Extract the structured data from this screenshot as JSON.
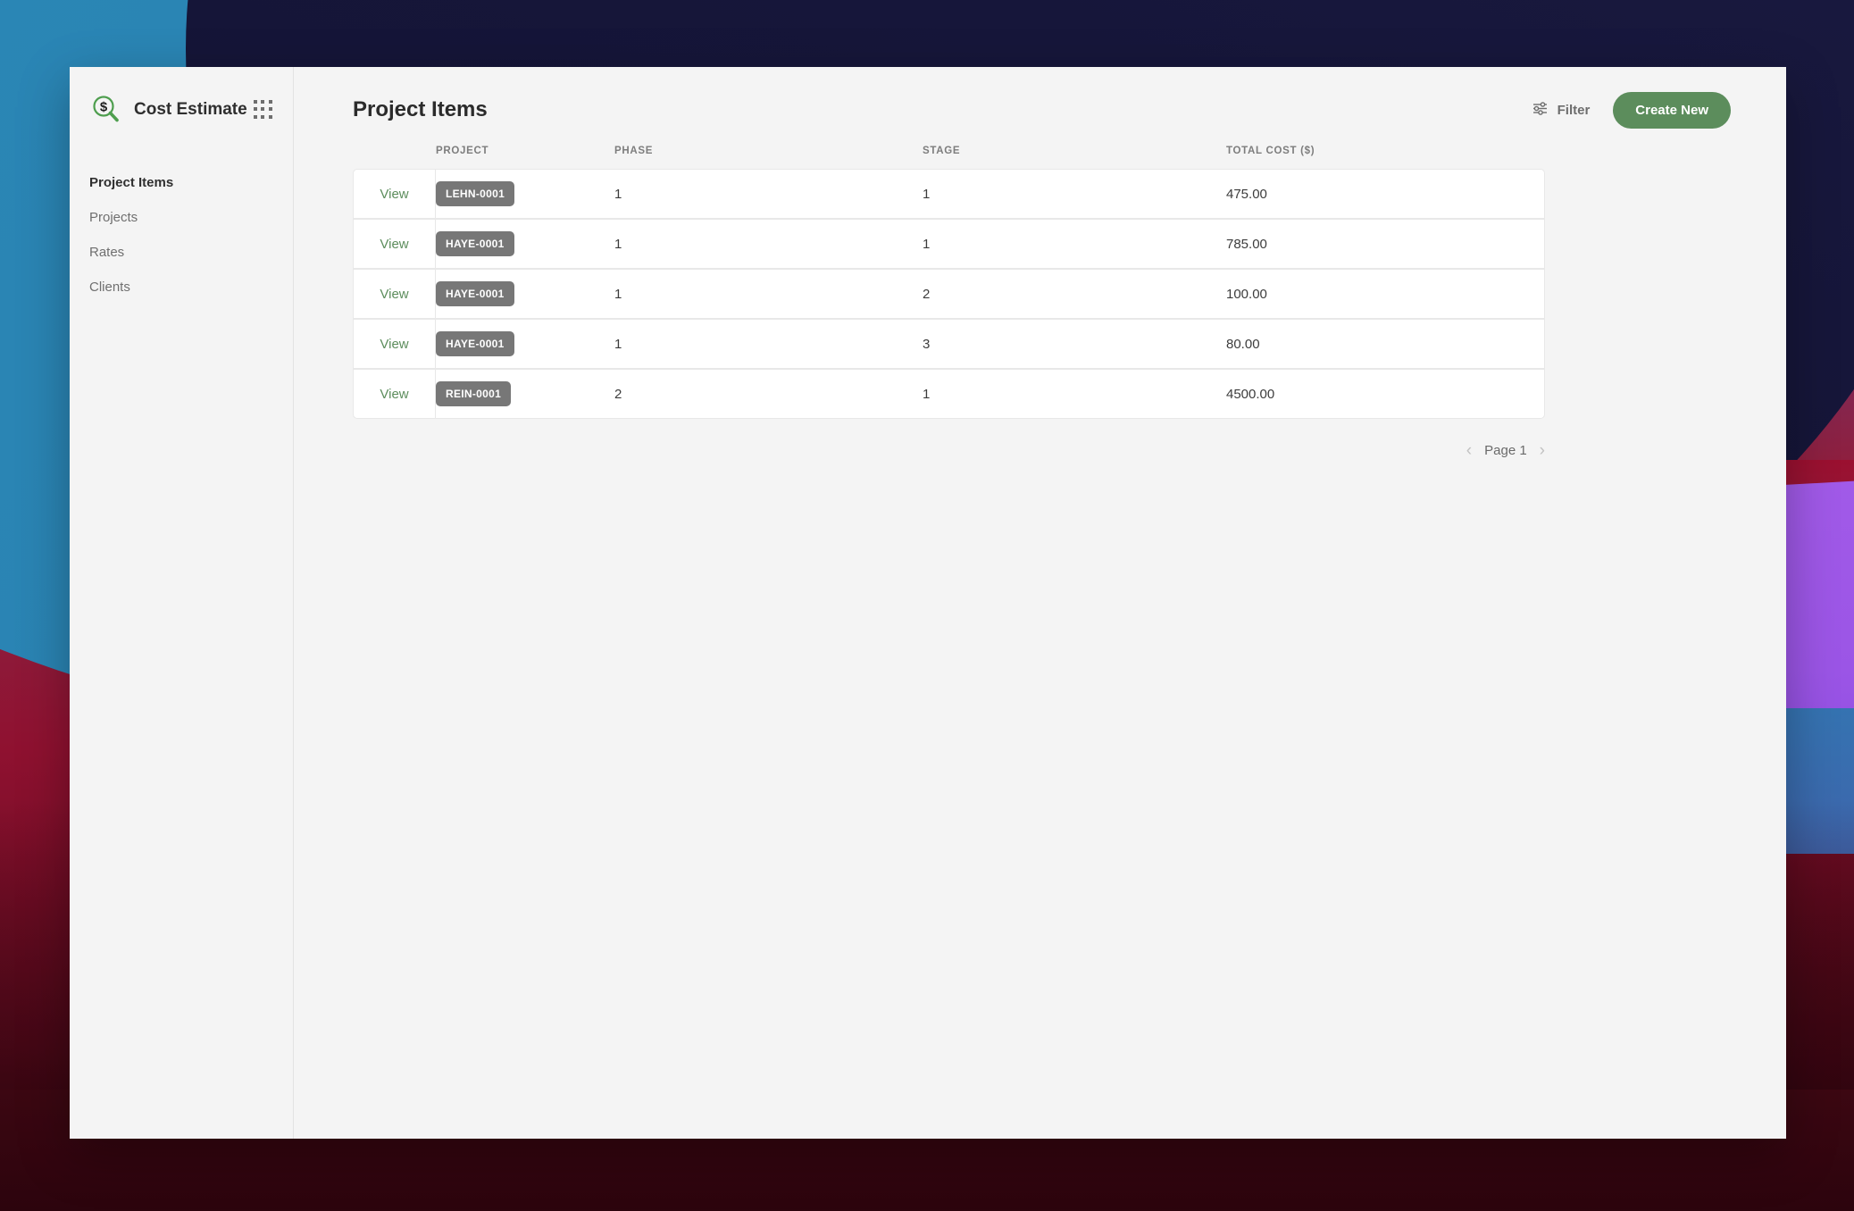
{
  "sidebar": {
    "brand": {
      "title": "Cost Estimate",
      "logo_icon": "dollar-magnifier-icon",
      "apps_icon": "apps-grid-icon"
    },
    "items": [
      {
        "label": "Project Items",
        "active": true
      },
      {
        "label": "Projects",
        "active": false
      },
      {
        "label": "Rates",
        "active": false
      },
      {
        "label": "Clients",
        "active": false
      }
    ]
  },
  "header": {
    "title": "Project Items",
    "filter_label": "Filter",
    "filter_icon": "sliders-icon",
    "create_label": "Create New"
  },
  "table": {
    "columns": [
      "",
      "PROJECT",
      "PHASE",
      "STAGE",
      "TOTAL COST ($)"
    ],
    "row_action_label": "View",
    "rows": [
      {
        "action": "View",
        "project": "LEHN-0001",
        "phase": "1",
        "stage": "1",
        "total_cost": "475.00"
      },
      {
        "action": "View",
        "project": "HAYE-0001",
        "phase": "1",
        "stage": "1",
        "total_cost": "785.00"
      },
      {
        "action": "View",
        "project": "HAYE-0001",
        "phase": "1",
        "stage": "2",
        "total_cost": "100.00"
      },
      {
        "action": "View",
        "project": "HAYE-0001",
        "phase": "1",
        "stage": "3",
        "total_cost": "80.00"
      },
      {
        "action": "View",
        "project": "REIN-0001",
        "phase": "2",
        "stage": "1",
        "total_cost": "4500.00"
      }
    ]
  },
  "pagination": {
    "prev_icon": "chevron-left-icon",
    "next_icon": "chevron-right-icon",
    "page_label": "Page 1"
  },
  "colors": {
    "accent_green": "#5c8d5c",
    "badge_gray": "#777777",
    "app_background": "#f4f4f4",
    "row_background": "#ffffff"
  }
}
